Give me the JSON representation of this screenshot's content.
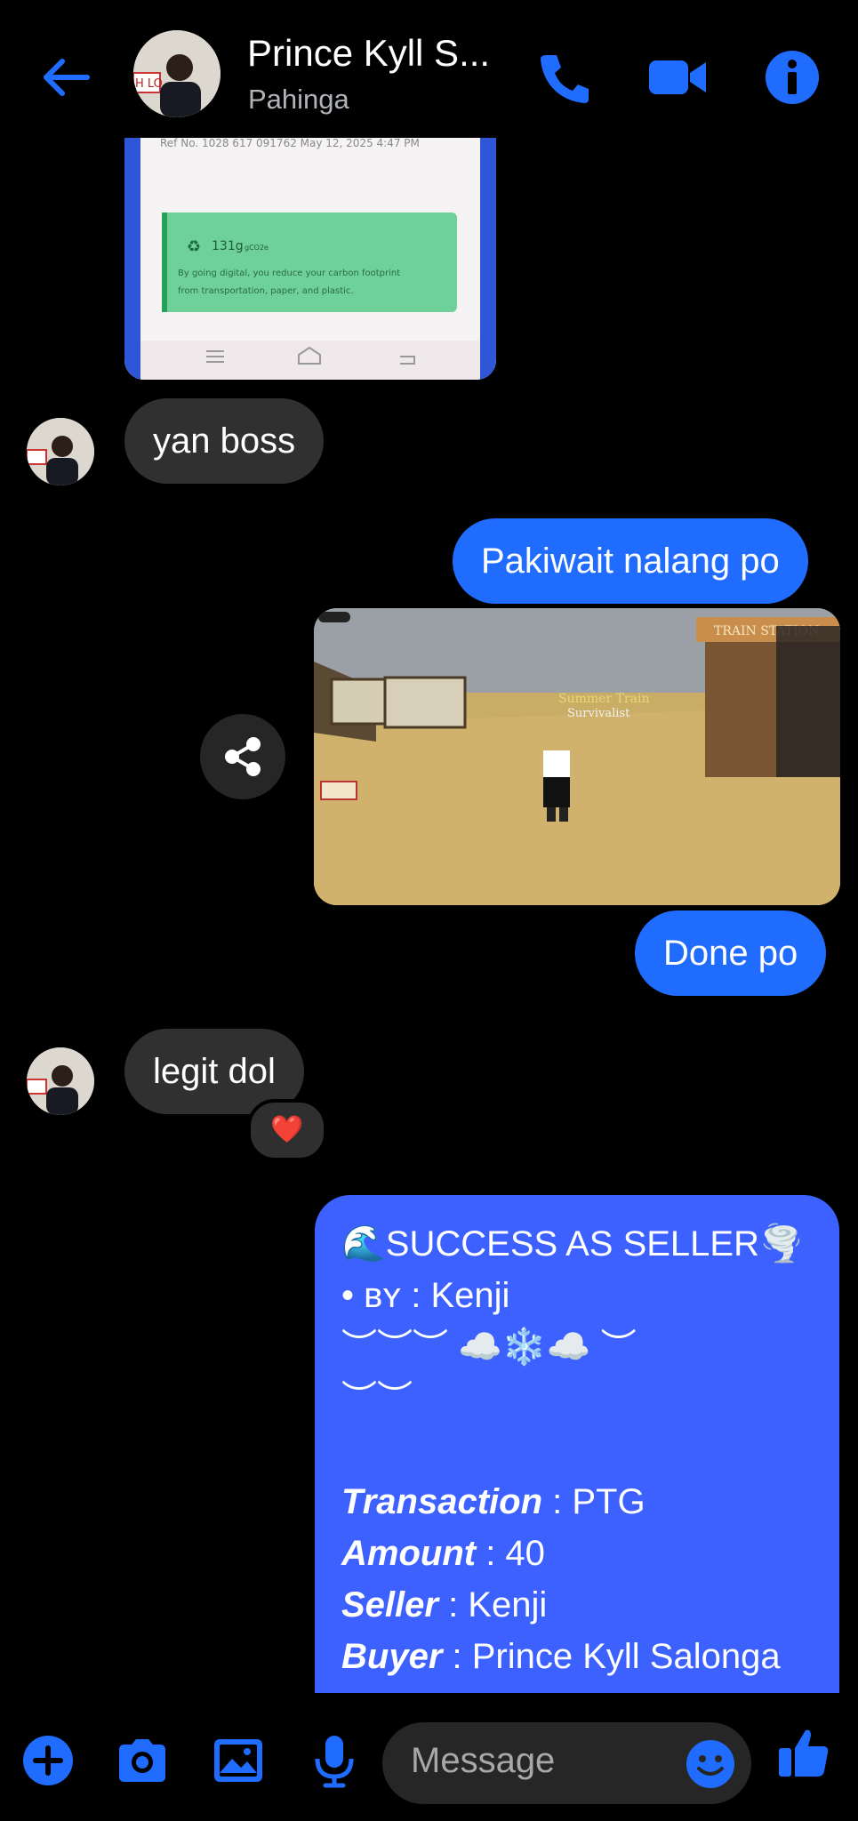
{
  "header": {
    "title": "Prince Kyll S...",
    "status": "Pahinga",
    "avatar_text": "H LO",
    "icons": [
      "back-arrow-icon",
      "phone-icon",
      "video-camera-icon",
      "info-icon"
    ],
    "accent": "#1f6cff"
  },
  "attachment_top": {
    "ref_line": "Ref No. 1028 617 091762   May 12, 2025 4:47 PM",
    "carbon_value": "131g",
    "carbon_unit": "gCO2e",
    "carbon_text_1": "By going digital, you reduce your carbon footprint",
    "carbon_text_2": "from transportation, paper, and plastic."
  },
  "messages": {
    "m1": "yan boss",
    "m2": "Pakiwait nalang po",
    "m3": "Done po",
    "m4": "legit dol",
    "m4_reaction": "❤️"
  },
  "game_screenshot": {
    "sign_text": "TRAIN STATION",
    "banner_text": "Summer Train",
    "banner_sub": "Survivalist"
  },
  "card": {
    "line1": "🌊SUCCESS AS SELLER🌪️",
    "line2_prefix": "• ʙʏ : ",
    "line2_name": "Kenji",
    "line3": "︶︶︶ ☁️❄️☁️ ︶",
    "line4": "︶︶",
    "rows": [
      {
        "key": "Transaction",
        "value": " : PTG"
      },
      {
        "key": "Amount",
        "value": " : 40"
      },
      {
        "key": "Seller",
        "value": " : Kenji"
      },
      {
        "key": "Buyer",
        "value": " : Prince Kyll Salonga"
      }
    ]
  },
  "composer": {
    "placeholder": "Message",
    "icons": [
      "plus-icon",
      "camera-icon",
      "image-icon",
      "microphone-icon",
      "emoji-icon",
      "thumbs-up-icon"
    ]
  }
}
